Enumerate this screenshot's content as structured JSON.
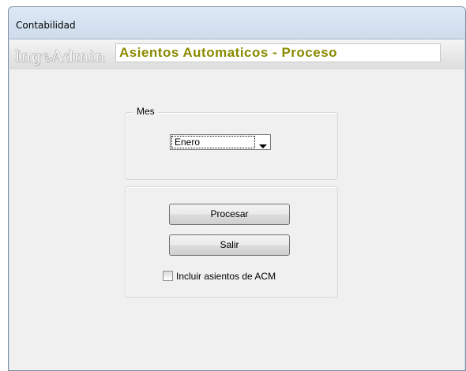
{
  "window": {
    "title": "Contabilidad"
  },
  "banner": {
    "brand": "IngeAdmin",
    "subtitle": "Asientos Automaticos - Proceso",
    "subtitle_color": "#8a8a00"
  },
  "mes_group": {
    "legend": "Mes",
    "select": {
      "selected": "Enero",
      "icon": "chevron-down-icon"
    }
  },
  "actions": {
    "procesar_label": "Procesar",
    "salir_label": "Salir",
    "checkbox": {
      "label": "Incluir asientos de ACM",
      "checked": false
    }
  },
  "colors": {
    "titlebar": "#cfdeee",
    "content_bg": "#f0f0f0"
  }
}
